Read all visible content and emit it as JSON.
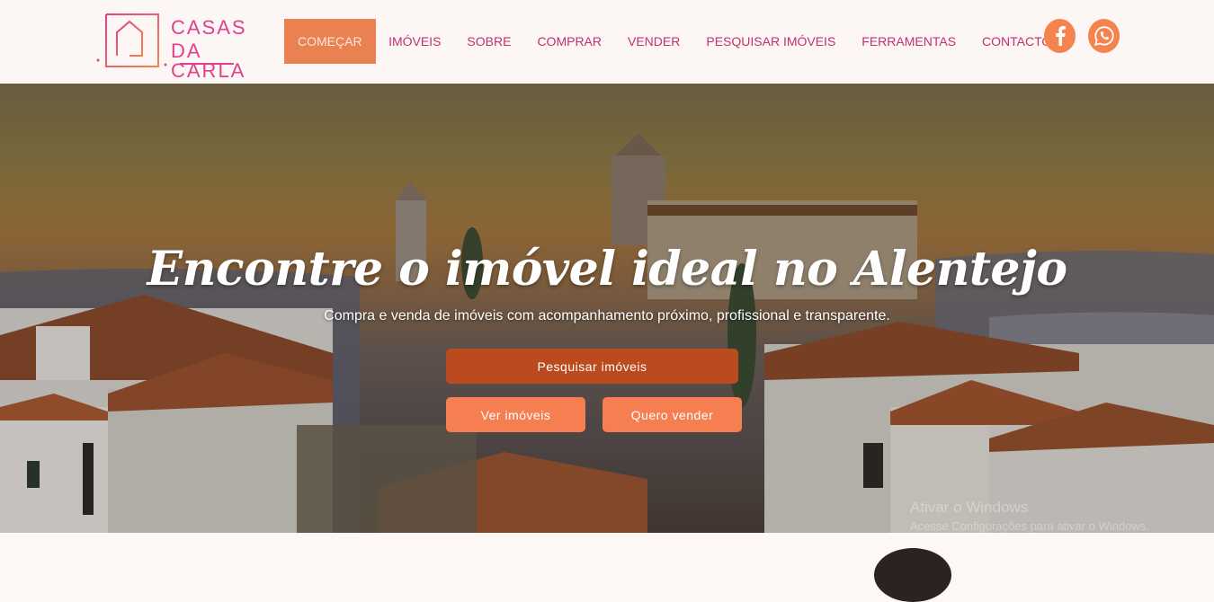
{
  "header": {
    "logo": {
      "line1": "CASAS",
      "line2": "DA CARLA"
    },
    "nav": [
      {
        "label": "COMEÇAR",
        "active": true
      },
      {
        "label": "IMÓVEIS",
        "active": false
      },
      {
        "label": "SOBRE",
        "active": false
      },
      {
        "label": "COMPRAR",
        "active": false
      },
      {
        "label": "VENDER",
        "active": false
      },
      {
        "label": "PESQUISAR IMÓVEIS",
        "active": false
      },
      {
        "label": "FERRAMENTAS",
        "active": false
      },
      {
        "label": "CONTACTO",
        "active": false
      }
    ],
    "social": [
      {
        "icon": "facebook-icon"
      },
      {
        "icon": "whatsapp-icon"
      }
    ]
  },
  "hero": {
    "title": "Encontre o imóvel ideal no Alentejo",
    "subtitle": "Compra e venda de imóveis com acompanhamento próximo, profissional e transparente.",
    "primary_button": "Pesquisar imóveis",
    "secondary_buttons": [
      "Ver imóveis",
      "Quero vender"
    ]
  },
  "watermark": {
    "line1": "Ativar o Windows",
    "line2": "Acesse Configurações para ativar o Windows."
  },
  "colors": {
    "accent": "#ea8151",
    "brand_pink": "#e2408b",
    "button_dark": "#bb4a1e",
    "button_light": "#f67f51"
  }
}
